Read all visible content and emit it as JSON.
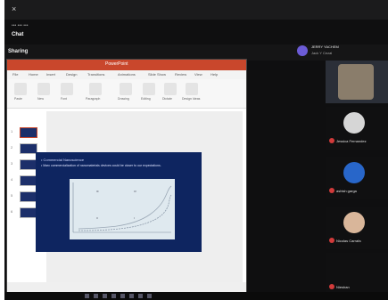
{
  "window": {
    "close_glyph": "×",
    "meta_text": "••• ••• •••",
    "tab_label": "Chat"
  },
  "share": {
    "title": "Sharing"
  },
  "presenter": {
    "name": "JERRY YACHEM",
    "subtitle": "Jack Y Cezal",
    "avatar_color": "#6b5bd6"
  },
  "ppt": {
    "title": "PowerPoint",
    "menu": [
      "File",
      "Home",
      "Insert",
      "Design",
      "Transitions",
      "Animations",
      "Slide Show",
      "Review",
      "View",
      "Help"
    ],
    "ribbon": [
      "Paste",
      "New",
      "Font",
      "Paragraph",
      "Drawing",
      "Editing",
      "Dictate",
      "Design Ideas"
    ],
    "slide_numbers": [
      "1",
      "2",
      "3",
      "4",
      "5",
      "6"
    ],
    "slide": {
      "heading": "• Commercial Nanoscience",
      "body": "• Marc commercialization of nanomaterials devices could be closer to our expectations.",
      "plot_cells": [
        "III",
        "IV",
        "II",
        "I"
      ]
    }
  },
  "gallery": [
    {
      "name": "",
      "type": "camera",
      "avatar": "#8a7d6b"
    },
    {
      "name": "Jessica Fernandez",
      "type": "avatar",
      "avatar": "#d6d6d6"
    },
    {
      "name": "ashish garga",
      "type": "avatar",
      "avatar": "#2866c9"
    },
    {
      "name": "Nicolas Carrafa",
      "type": "avatar",
      "avatar": "#d9b69a"
    },
    {
      "name": "Nieshan",
      "type": "avatar",
      "avatar": "#ffffff"
    }
  ],
  "colors": {
    "ppt_accent": "#c9472c",
    "slide_bg": "#0e2560",
    "mic_muted": "#d13b3b"
  }
}
